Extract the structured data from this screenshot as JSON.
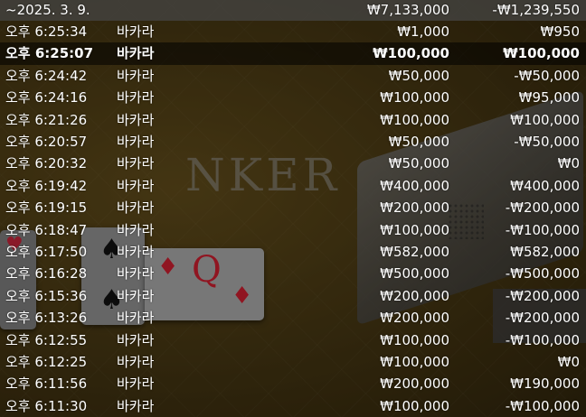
{
  "background": {
    "banner_text": "NKER",
    "card_queen_rank": "Q"
  },
  "header": {
    "date": "~2025. 3. 9.",
    "total_bet": "₩7,133,000",
    "total_result": "-₩1,239,550"
  },
  "rows": [
    {
      "time": "오후 6:25:34",
      "game": "바카라",
      "bet": "₩1,000",
      "result": "₩950"
    },
    {
      "time": "오후 6:25:07",
      "game": "바카라",
      "bet": "₩100,000",
      "result": "₩100,000"
    },
    {
      "time": "오후 6:24:42",
      "game": "바카라",
      "bet": "₩50,000",
      "result": "-₩50,000"
    },
    {
      "time": "오후 6:24:16",
      "game": "바카라",
      "bet": "₩100,000",
      "result": "₩95,000"
    },
    {
      "time": "오후 6:21:26",
      "game": "바카라",
      "bet": "₩100,000",
      "result": "₩100,000"
    },
    {
      "time": "오후 6:20:57",
      "game": "바카라",
      "bet": "₩50,000",
      "result": "-₩50,000"
    },
    {
      "time": "오후 6:20:32",
      "game": "바카라",
      "bet": "₩50,000",
      "result": "₩0"
    },
    {
      "time": "오후 6:19:42",
      "game": "바카라",
      "bet": "₩400,000",
      "result": "₩400,000"
    },
    {
      "time": "오후 6:19:15",
      "game": "바카라",
      "bet": "₩200,000",
      "result": "-₩200,000"
    },
    {
      "time": "오후 6:18:47",
      "game": "바카라",
      "bet": "₩100,000",
      "result": "-₩100,000"
    },
    {
      "time": "오후 6:17:50",
      "game": "바카라",
      "bet": "₩582,000",
      "result": "₩582,000"
    },
    {
      "time": "오후 6:16:28",
      "game": "바카라",
      "bet": "₩500,000",
      "result": "-₩500,000"
    },
    {
      "time": "오후 6:15:36",
      "game": "바카라",
      "bet": "₩200,000",
      "result": "-₩200,000"
    },
    {
      "time": "오후 6:13:26",
      "game": "바카라",
      "bet": "₩200,000",
      "result": "-₩200,000"
    },
    {
      "time": "오후 6:12:55",
      "game": "바카라",
      "bet": "₩100,000",
      "result": "-₩100,000"
    },
    {
      "time": "오후 6:12:25",
      "game": "바카라",
      "bet": "₩100,000",
      "result": "₩0"
    },
    {
      "time": "오후 6:11:56",
      "game": "바카라",
      "bet": "₩200,000",
      "result": "₩190,000"
    },
    {
      "time": "오후 6:11:30",
      "game": "바카라",
      "bet": "₩100,000",
      "result": "-₩100,000"
    }
  ],
  "highlighted_row_index": 1
}
